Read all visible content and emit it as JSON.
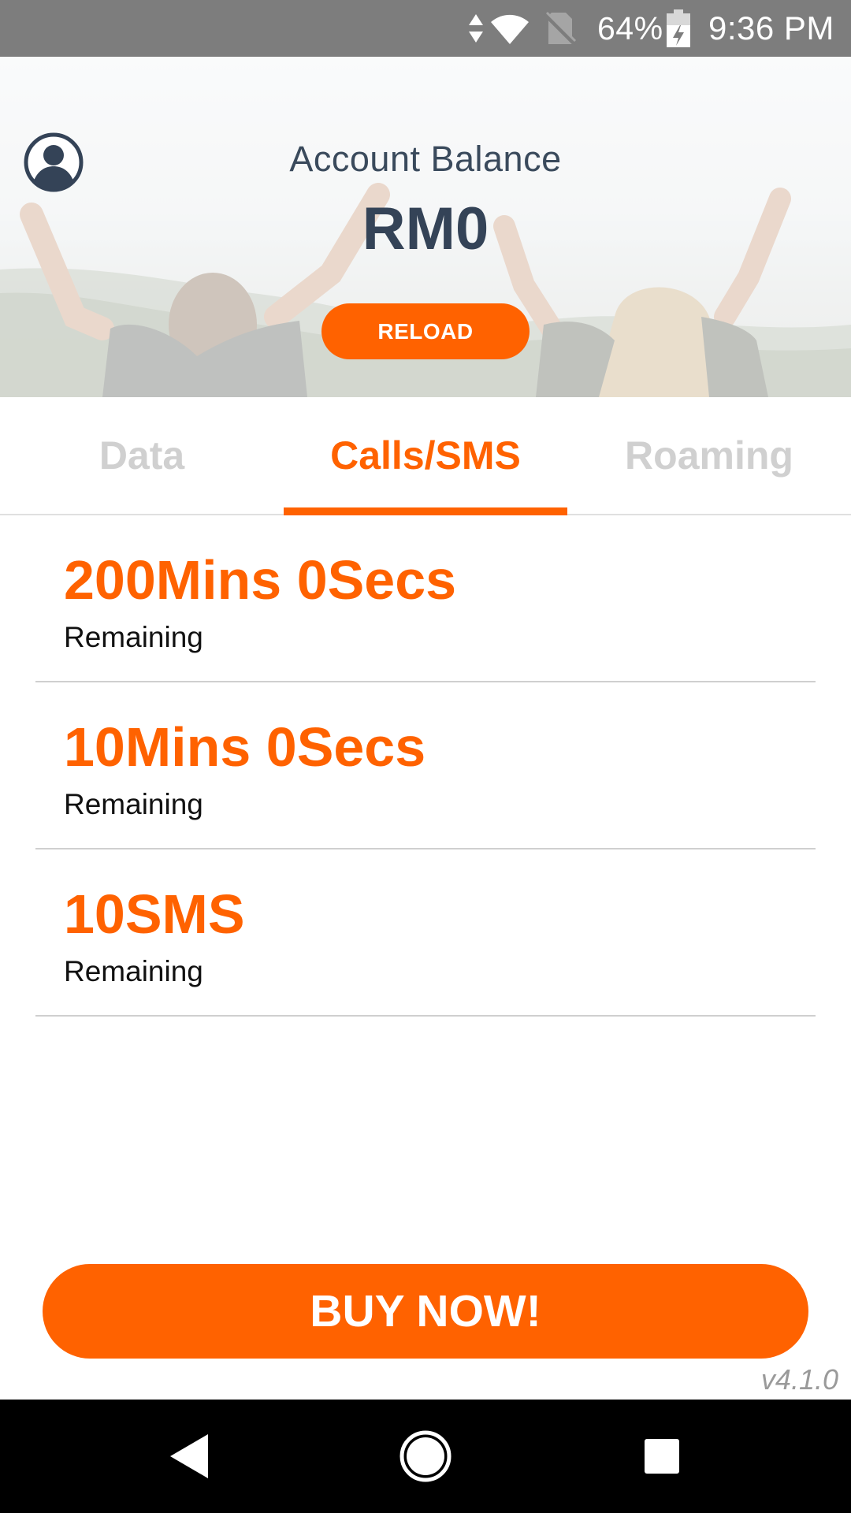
{
  "status_bar": {
    "battery_percent": "64%",
    "time": "9:36 PM",
    "icons": [
      "data-arrows-icon",
      "wifi-icon",
      "no-sim-icon",
      "battery-charging-icon"
    ]
  },
  "header": {
    "profile_icon": "account-circle-icon",
    "balance_label": "Account Balance",
    "balance_value": "RM0",
    "reload_label": "RELOAD"
  },
  "tabs": [
    {
      "label": "Data",
      "selected": false
    },
    {
      "label": "Calls/SMS",
      "selected": true
    },
    {
      "label": "Roaming",
      "selected": false
    }
  ],
  "balances": [
    {
      "amount": "200Mins 0Secs",
      "label": "Remaining"
    },
    {
      "amount": "10Mins 0Secs",
      "label": "Remaining"
    },
    {
      "amount": "10SMS",
      "label": "Remaining"
    }
  ],
  "buy_now_label": "BUY NOW!",
  "version": "v4.1.0",
  "nav_bar": {
    "icons": [
      "back-icon",
      "home-icon",
      "recents-icon"
    ]
  },
  "colors": {
    "accent": "#ff6200",
    "heading": "#344357",
    "status_bar": "#7d7d7d",
    "inactive_tab": "#d0d0d0"
  }
}
